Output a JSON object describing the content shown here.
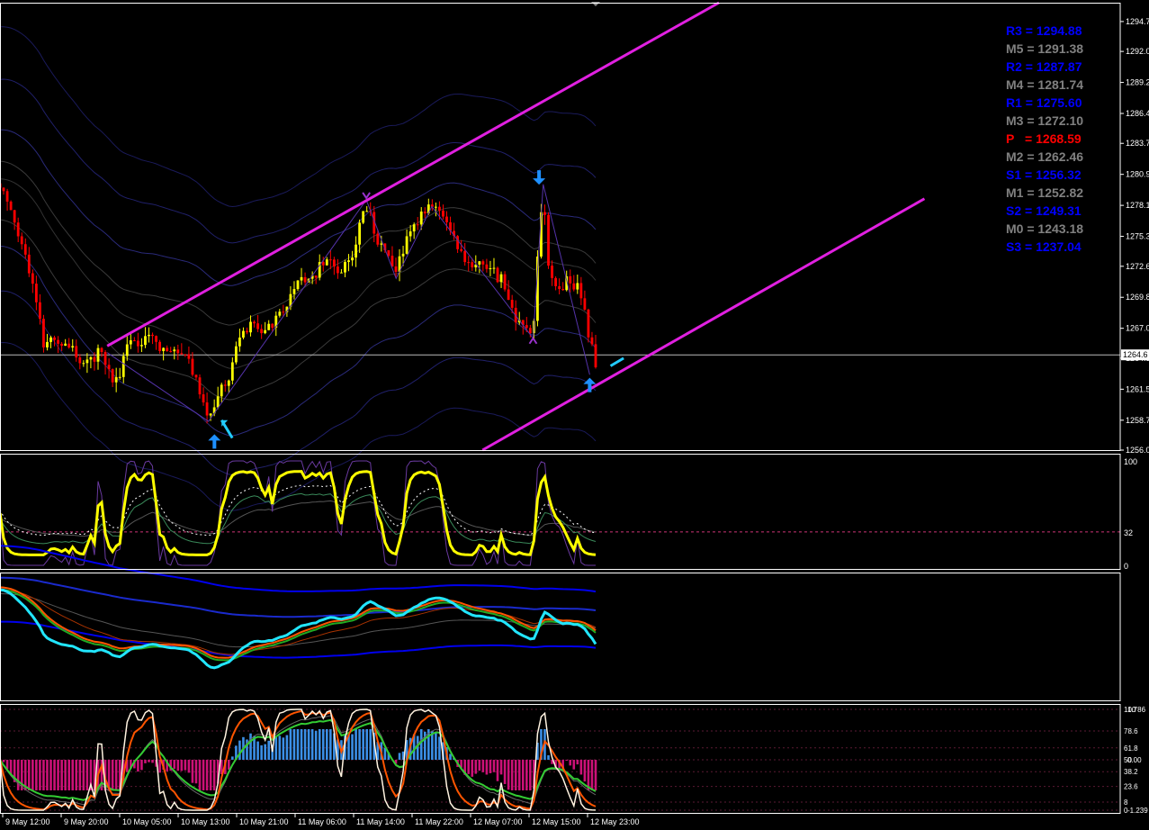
{
  "colors": {
    "background": "#000000",
    "frame": "#ffffff",
    "candle_up": "#ffff00",
    "candle_down": "#ff0000",
    "channel": "#e020e0",
    "arrow": "#1e90ff",
    "zigzag_mark": "#9932cc",
    "rsi_line": "#ffff00",
    "ma_cyan": "#22e6ff",
    "ma_blue": "#0000ff",
    "ma_orange": "#ff5500",
    "ma_green": "#22aa22",
    "hist_up": "#3b8fe6",
    "hist_down": "#cc1177",
    "pivot_r": "#0000ff",
    "pivot_m": "#808080",
    "pivot_p": "#ff0000",
    "grid_dash": "#cc3377"
  },
  "pivots": [
    {
      "name": "R3",
      "eq": " = ",
      "value": "1294.88",
      "kind": "r"
    },
    {
      "name": "M5",
      "eq": " = ",
      "value": "1291.38",
      "kind": "m"
    },
    {
      "name": "R2",
      "eq": " = ",
      "value": "1287.87",
      "kind": "r"
    },
    {
      "name": "M4",
      "eq": " = ",
      "value": "1281.74",
      "kind": "m"
    },
    {
      "name": "R1",
      "eq": " = ",
      "value": "1275.60",
      "kind": "r"
    },
    {
      "name": "M3",
      "eq": " = ",
      "value": "1272.10",
      "kind": "m"
    },
    {
      "name": "P",
      "eq": "   = ",
      "value": "1268.59",
      "kind": "p"
    },
    {
      "name": "M2",
      "eq": " = ",
      "value": "1262.46",
      "kind": "m"
    },
    {
      "name": "S1",
      "eq": " = ",
      "value": "1256.32",
      "kind": "r"
    },
    {
      "name": "M1",
      "eq": " = ",
      "value": "1252.82",
      "kind": "m"
    },
    {
      "name": "S2",
      "eq": " = ",
      "value": "1249.31",
      "kind": "r"
    },
    {
      "name": "M0",
      "eq": " = ",
      "value": "1243.18",
      "kind": "m"
    },
    {
      "name": "S3",
      "eq": " = ",
      "value": "1237.04",
      "kind": "r"
    }
  ],
  "chart_data": [
    {
      "type": "candlestick",
      "panel": "price",
      "ylim": [
        1256.0,
        1296.4
      ],
      "yticks": [
        "1294.7",
        "1292.0",
        "1289.2",
        "1286.4",
        "1283.7",
        "1280.9",
        "1278.1",
        "1275.3",
        "1272.6",
        "1269.8",
        "1267.0",
        "1264.3",
        "1261.5",
        "1258.7",
        "1256.0"
      ],
      "current_price_label": "1264.6",
      "current_price": 1264.6,
      "time_range": [
        "9 May 12:00",
        "12 May 23:00"
      ],
      "close_path": [
        [
          0,
          1279.7
        ],
        [
          0.02,
          1277
        ],
        [
          0.04,
          1274
        ],
        [
          0.06,
          1270
        ],
        [
          0.075,
          1265
        ],
        [
          0.09,
          1266
        ],
        [
          0.12,
          1265
        ],
        [
          0.145,
          1263.5
        ],
        [
          0.17,
          1265
        ],
        [
          0.195,
          1262
        ],
        [
          0.215,
          1265.5
        ],
        [
          0.235,
          1266
        ],
        [
          0.255,
          1266.5
        ],
        [
          0.275,
          1265
        ],
        [
          0.295,
          1265.5
        ],
        [
          0.315,
          1264
        ],
        [
          0.33,
          1262.5
        ],
        [
          0.35,
          1259
        ],
        [
          0.365,
          1261
        ],
        [
          0.38,
          1262
        ],
        [
          0.4,
          1266
        ],
        [
          0.42,
          1267.5
        ],
        [
          0.44,
          1266.3
        ],
        [
          0.46,
          1267.5
        ],
        [
          0.475,
          1268.5
        ],
        [
          0.49,
          1270.5
        ],
        [
          0.51,
          1271.2
        ],
        [
          0.53,
          1272
        ],
        [
          0.545,
          1273.2
        ],
        [
          0.56,
          1273
        ],
        [
          0.575,
          1272
        ],
        [
          0.59,
          1273.5
        ],
        [
          0.605,
          1276.5
        ],
        [
          0.615,
          1278
        ],
        [
          0.625,
          1276.5
        ],
        [
          0.635,
          1274.5
        ],
        [
          0.65,
          1274
        ],
        [
          0.665,
          1272
        ],
        [
          0.68,
          1274.5
        ],
        [
          0.695,
          1276
        ],
        [
          0.71,
          1277.5
        ],
        [
          0.725,
          1277.7
        ],
        [
          0.74,
          1277.5
        ],
        [
          0.755,
          1276.3
        ],
        [
          0.77,
          1274.5
        ],
        [
          0.785,
          1273
        ],
        [
          0.8,
          1272.5
        ],
        [
          0.815,
          1272.7
        ],
        [
          0.83,
          1272
        ],
        [
          0.845,
          1271.2
        ],
        [
          0.86,
          1268.5
        ],
        [
          0.875,
          1267.5
        ],
        [
          0.885,
          1266.8
        ],
        [
          0.895,
          1267
        ],
        [
          0.905,
          1276
        ],
        [
          0.912,
          1279.5
        ],
        [
          0.922,
          1272
        ],
        [
          0.935,
          1270.5
        ],
        [
          0.95,
          1271.2
        ],
        [
          0.965,
          1271
        ],
        [
          0.98,
          1269.5
        ],
        [
          0.99,
          1266
        ],
        [
          1.0,
          1263.5
        ]
      ],
      "channel_upper": [
        [
          1258.3,
          1265.4
        ],
        [
          1278.9,
          1296.4
        ]
      ],
      "channel_lower": [
        [
          1277.9,
          1256.0
        ],
        [
          1287.0,
          1278.7
        ]
      ],
      "arrows_up": [
        [
          0.36,
          1256.7
        ],
        [
          0.99,
          1261.8
        ]
      ],
      "arrows_down": [
        [
          0.905,
          1280.7
        ]
      ]
    },
    {
      "type": "line",
      "panel": "oscillator",
      "ylim": [
        0,
        100
      ],
      "yticks": [
        "100",
        "32",
        "0"
      ],
      "level": 32
    },
    {
      "type": "line",
      "panel": "moving_averages"
    },
    {
      "type": "bar",
      "panel": "histogram",
      "yticks": [
        "100",
        "78.6",
        "61.8",
        "50",
        "38.2",
        "23.6",
        "8",
        "0"
      ],
      "yticks_overlay": [
        "1.786",
        "0.00",
        "-1.239"
      ]
    }
  ],
  "x_axis": {
    "labels": [
      "9 May 12:00",
      "9 May 20:00",
      "10 May 05:00",
      "10 May 13:00",
      "10 May 21:00",
      "11 May 06:00",
      "11 May 14:00",
      "11 May 22:00",
      "12 May 07:00",
      "12 May 15:00",
      "12 May 23:00"
    ]
  }
}
